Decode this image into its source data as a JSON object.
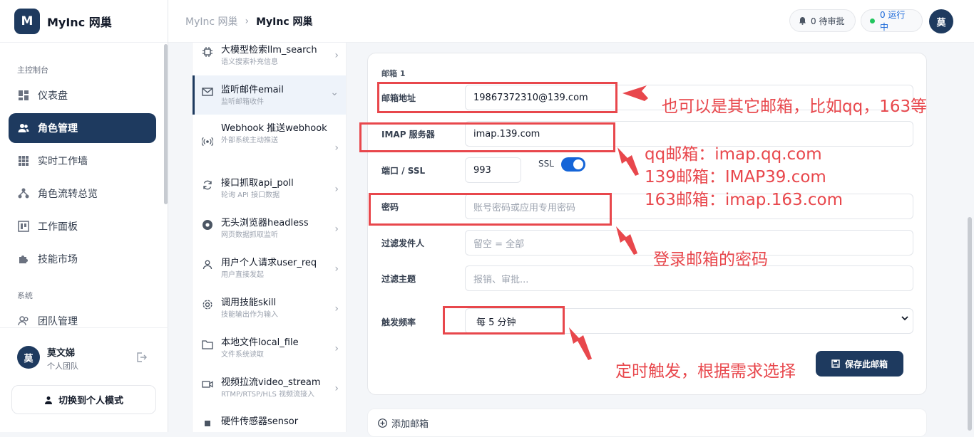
{
  "app": {
    "logo_letter": "M",
    "name": "MyInc 网巢"
  },
  "sidebar": {
    "section_main": "主控制台",
    "items": [
      {
        "label": "仪表盘",
        "icon": "dashboard-icon"
      },
      {
        "label": "角色管理",
        "icon": "users-icon",
        "active": true
      },
      {
        "label": "实时工作墙",
        "icon": "grid-icon"
      },
      {
        "label": "角色流转总览",
        "icon": "flow-icon"
      },
      {
        "label": "工作面板",
        "icon": "board-icon"
      },
      {
        "label": "技能市场",
        "icon": "puzzle-icon"
      }
    ],
    "section_system": "系统",
    "system_items": [
      {
        "label": "团队管理",
        "icon": "team-icon"
      }
    ],
    "user": {
      "avatar": "莫",
      "name": "莫文娣",
      "team": "个人团队"
    },
    "switch_button": "切换到个人模式"
  },
  "topbar": {
    "breadcrumb_parent": "MyInc 网巢",
    "breadcrumb_sep": "›",
    "breadcrumb_current": "MyInc 网巢",
    "pending": "0 待审批",
    "running": "0 运行中",
    "avatar": "莫"
  },
  "triggers": [
    {
      "title": "大模型检索llm_search",
      "sub": "语义搜索补充信息",
      "icon": "chip-icon"
    },
    {
      "title": "监听邮件email",
      "sub": "监听邮箱收件",
      "icon": "mail-icon",
      "selected": true
    },
    {
      "title": "Webhook 推送webhook",
      "sub": "外部系统主动推送",
      "icon": "broadcast-icon"
    },
    {
      "title": "接口抓取api_poll",
      "sub": "轮询 API 接口数据",
      "icon": "refresh-icon"
    },
    {
      "title": "无头浏览器headless",
      "sub": "网页数据抓取监听",
      "icon": "browser-icon"
    },
    {
      "title": "用户个人请求user_req",
      "sub": "用户直接发起",
      "icon": "user-icon"
    },
    {
      "title": "调用技能skill",
      "sub": "技能输出作为输入",
      "icon": "gear-icon"
    },
    {
      "title": "本地文件local_file",
      "sub": "文件系统读取",
      "icon": "folder-icon"
    },
    {
      "title": "视频拉流video_stream",
      "sub": "RTMP/RTSP/HLS 视频流接入",
      "icon": "video-icon"
    },
    {
      "title": "硬件传感器sensor",
      "sub": "",
      "icon": "sensor-icon"
    }
  ],
  "form": {
    "mailbox_title": "邮箱 1",
    "email_label": "邮箱地址",
    "email_value": "19867372310@139.com",
    "imap_label": "IMAP 服务器",
    "imap_value": "imap.139.com",
    "port_label": "端口 / SSL",
    "port_value": "993",
    "ssl_label": "SSL",
    "ssl_on": true,
    "password_label": "密码",
    "password_placeholder": "账号密码或应用专用密码",
    "sender_label": "过滤发件人",
    "sender_placeholder": "留空 = 全部",
    "subject_label": "过滤主题",
    "subject_placeholder": "报销、审批...",
    "freq_label": "触发频率",
    "freq_value": "每 5 分钟",
    "save_button": "保存此邮箱",
    "add_mailbox": "添加邮箱"
  },
  "annotations": {
    "email_note": "也可以是其它邮箱，比如qq，163等",
    "imap_note_1": "qq邮箱：imap.qq.com",
    "imap_note_2": "139邮箱：IMAP39.com",
    "imap_note_3": "163邮箱：imap.163.com",
    "password_note": "登录邮箱的密码",
    "freq_note": "定时触发，根据需求选择",
    "color": "#e8474c"
  },
  "colors": {
    "primary": "#1e3a5f",
    "toggle": "#1565d8",
    "running_dot": "#22c55e"
  }
}
